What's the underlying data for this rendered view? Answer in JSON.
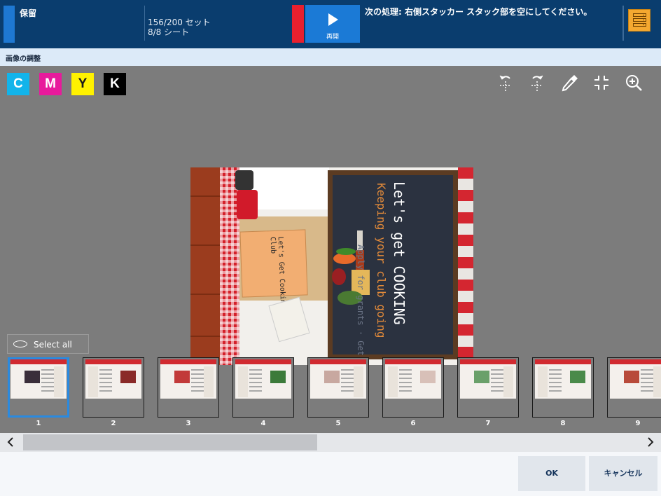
{
  "topbar": {
    "status": "保留",
    "sets_count": "156/200 セット",
    "sheets_count": "8/8 シート",
    "resume_label": "再開",
    "next_action": "次の処理: 右側スタッカー スタック部を空にしてください。",
    "colors": {
      "bar": "#0a3d6e",
      "status_stripe": "#1e78d2",
      "alert_stripe": "#e8202e",
      "resume": "#1b7ad6",
      "menu": "#f4a830"
    }
  },
  "section": {
    "title": "画像の調整"
  },
  "channels": [
    {
      "label": "C",
      "bg": "#12b4ea",
      "fg": "#ffffff"
    },
    {
      "label": "M",
      "bg": "#e81a9c",
      "fg": "#ffffff"
    },
    {
      "label": "Y",
      "bg": "#fff200",
      "fg": "#1a1a1a"
    },
    {
      "label": "K",
      "bg": "#000000",
      "fg": "#ffffff"
    }
  ],
  "tools": [
    "rotate-left-icon",
    "rotate-right-icon",
    "eyedropper-icon",
    "fit-to-window-icon",
    "zoom-in-icon"
  ],
  "preview": {
    "card_text": "Let's Get Cooking Club",
    "chalk_title": "Let's get COOKING",
    "chalk_sub": "Keeping your club going",
    "chalk_ghost": "Apply for grants · Get supplies · Food"
  },
  "select_all": {
    "label": "Select all"
  },
  "thumbnails": [
    {
      "num": "1",
      "selected": true
    },
    {
      "num": "2",
      "selected": false
    },
    {
      "num": "3",
      "selected": false
    },
    {
      "num": "4",
      "selected": false
    },
    {
      "num": "5",
      "selected": false
    },
    {
      "num": "6",
      "selected": false
    },
    {
      "num": "7",
      "selected": false
    },
    {
      "num": "8",
      "selected": false
    },
    {
      "num": "9",
      "selected": false
    }
  ],
  "scroll": {
    "position_fraction": 0.45
  },
  "buttons": {
    "ok": "OK",
    "cancel": "キャンセル"
  }
}
